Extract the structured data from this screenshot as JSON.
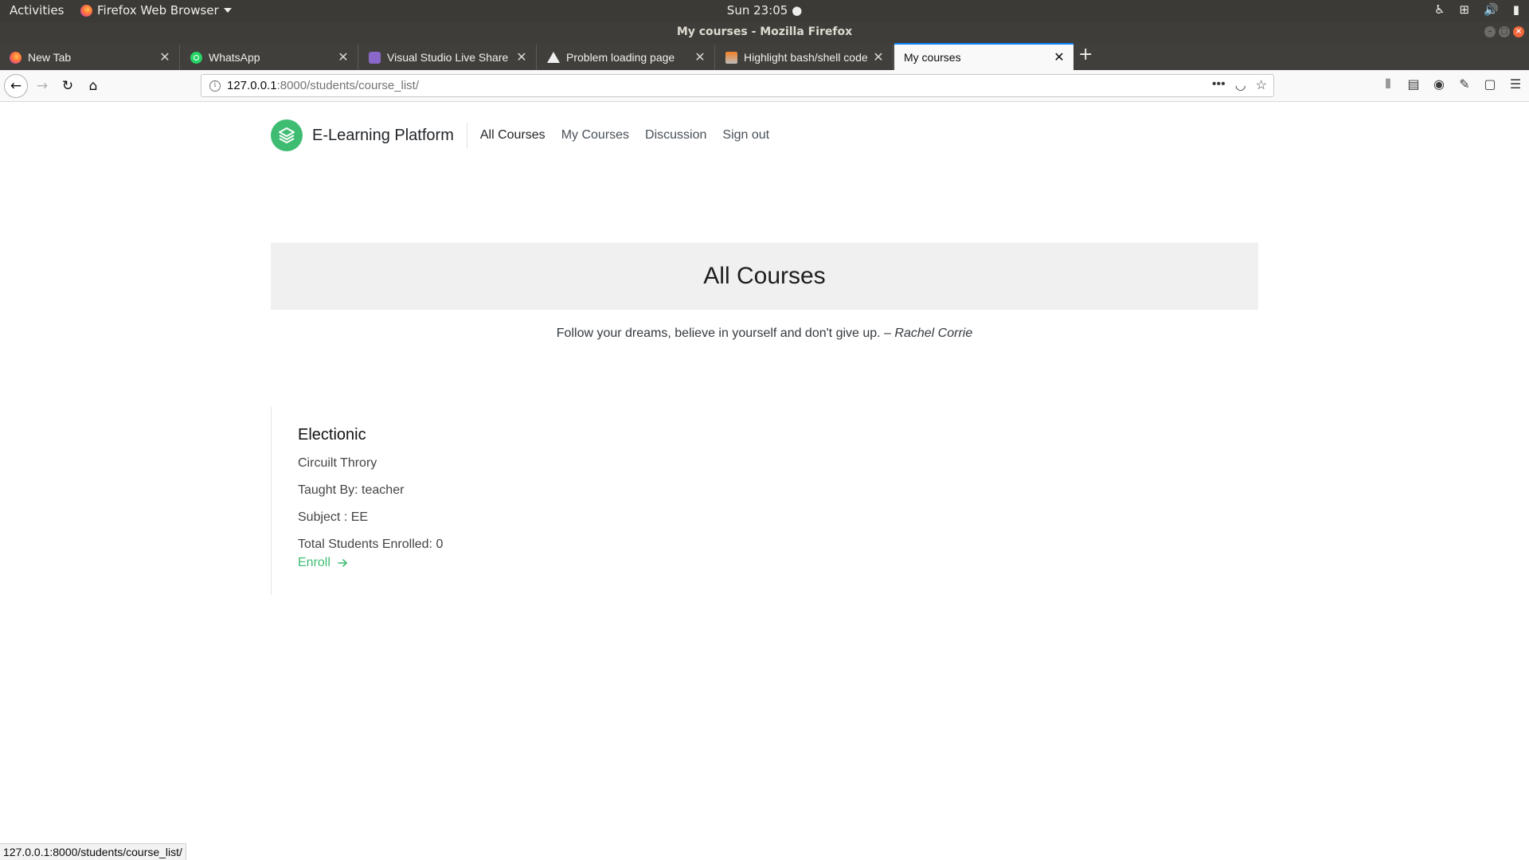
{
  "system_bar": {
    "activities": "Activities",
    "app_name": "Firefox Web Browser",
    "clock": "Sun 23:05 ●"
  },
  "window": {
    "title": "My courses - Mozilla Firefox"
  },
  "tabs": [
    {
      "label": "New Tab",
      "icon": "firefox-icon"
    },
    {
      "label": "WhatsApp",
      "icon": "whatsapp-icon"
    },
    {
      "label": "Visual Studio Live Share",
      "icon": "vs-liveshare-icon"
    },
    {
      "label": "Problem loading page",
      "icon": "warning-icon"
    },
    {
      "label": "Highlight bash/shell code",
      "icon": "stackoverflow-icon"
    },
    {
      "label": "My courses",
      "icon": "none",
      "active": true
    }
  ],
  "url": {
    "host": "127.0.0.1",
    "path": ":8000/students/course_list/"
  },
  "site": {
    "brand": "E-Learning Platform",
    "nav": [
      "All Courses",
      "My Courses",
      "Discussion",
      "Sign out"
    ],
    "accent_color": "#3ebd72"
  },
  "hero": {
    "heading": "All Courses"
  },
  "quote": {
    "text": "Follow your dreams, believe in yourself and don't give up. –",
    "author": "Rachel Corrie"
  },
  "course": {
    "title": "Electionic",
    "name": "Circuilt Throry",
    "taught_by": "Taught By: teacher",
    "subject": "Subject : EE",
    "enrolled": "Total Students Enrolled: 0",
    "enroll_label": "Enroll"
  },
  "status_url": "127.0.0.1:8000/students/course_list/"
}
